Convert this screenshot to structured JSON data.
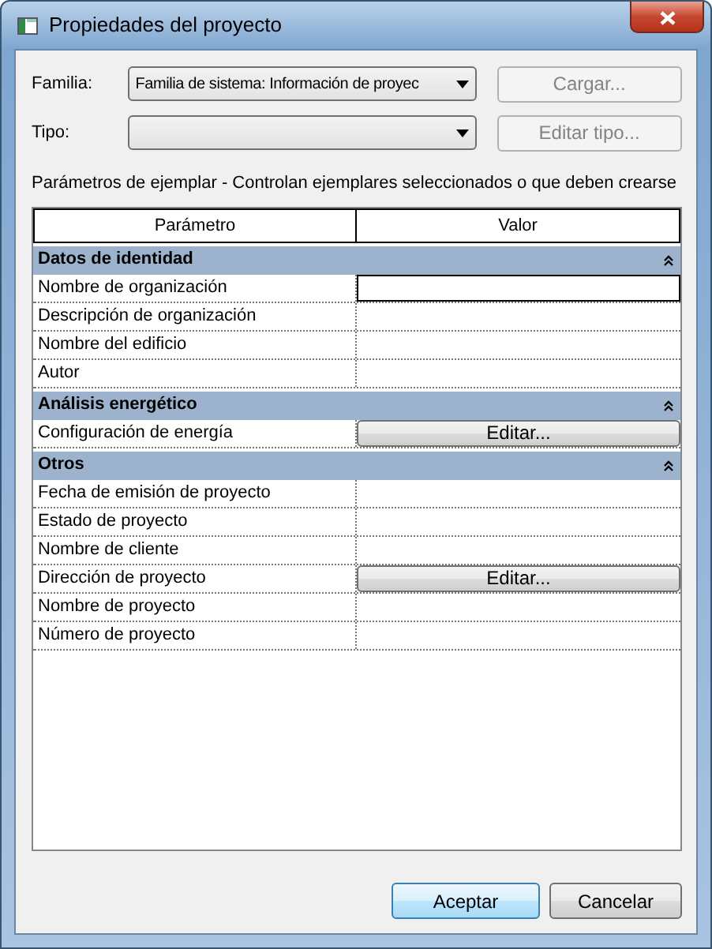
{
  "window": {
    "title": "Propiedades del proyecto"
  },
  "family": {
    "label": "Familia:",
    "value": "Familia de sistema: Información de proyec"
  },
  "load_button": {
    "label": "Cargar...",
    "disabled": true
  },
  "type": {
    "label": "Tipo:"
  },
  "edit_type_button": {
    "label": "Editar tipo...",
    "disabled": true
  },
  "description": "Parámetros de ejemplar - Controlan ejemplares seleccionados o que deben crearse",
  "table": {
    "columns": [
      "Parámetro",
      "Valor"
    ],
    "groups": [
      {
        "name": "Datos de identidad",
        "expanded": true,
        "rows": [
          {
            "name": "Nombre de organización",
            "kind": "text",
            "selected": true
          },
          {
            "name": "Descripción de organización",
            "kind": "text",
            "selected": false
          },
          {
            "name": "Nombre del edificio",
            "kind": "text",
            "selected": false
          },
          {
            "name": "Autor",
            "kind": "text",
            "selected": false
          }
        ]
      },
      {
        "name": "Análisis energético",
        "expanded": true,
        "rows": [
          {
            "name": "Configuración de energía",
            "kind": "button",
            "button": "Editar...",
            "selected": false
          }
        ]
      },
      {
        "name": "Otros",
        "expanded": true,
        "rows": [
          {
            "name": "Fecha de emisión de proyecto",
            "kind": "text",
            "selected": false
          },
          {
            "name": "Estado de proyecto",
            "kind": "text",
            "selected": false
          },
          {
            "name": "Nombre de cliente",
            "kind": "text",
            "selected": false
          },
          {
            "name": "Dirección de proyecto",
            "kind": "button",
            "button": "Editar...",
            "selected": false
          },
          {
            "name": "Nombre de proyecto",
            "kind": "text",
            "selected": false
          },
          {
            "name": "Número de proyecto",
            "kind": "text",
            "selected": false
          }
        ]
      }
    ]
  },
  "buttons": [
    {
      "label": "Aceptar",
      "default": true
    },
    {
      "label": "Cancelar",
      "default": false
    }
  ]
}
